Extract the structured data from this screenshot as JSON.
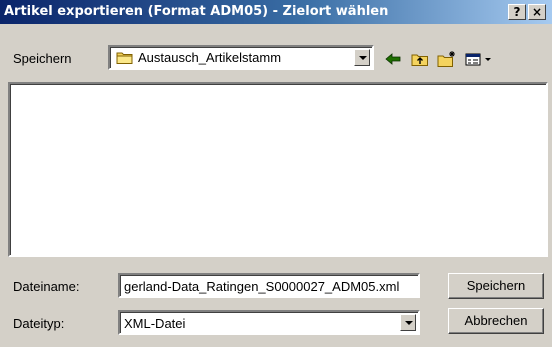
{
  "window": {
    "title": "Artikel exportieren (Format ADM05) - Zielort wählen",
    "help_label": "?",
    "close_label": "×"
  },
  "toolbar": {
    "save_in_label": "Speichern",
    "folder_name": "Austausch_Artikelstamm",
    "icons": [
      "folder-icon",
      "back-arrow-icon",
      "up-folder-icon",
      "new-folder-icon",
      "view-menu-icon"
    ]
  },
  "form": {
    "filename_label": "Dateiname:",
    "filename_value": "gerland-Data_Ratingen_S0000027_ADM05.xml",
    "filetype_label": "Dateityp:",
    "filetype_value": "XML-Datei",
    "save_button": "Speichern",
    "cancel_button": "Abbrechen"
  },
  "colors": {
    "title_gradient_start": "#0a246a",
    "title_gradient_end": "#a6caf0",
    "dialog_face": "#d4d0c8",
    "field_background": "#ffffff"
  }
}
